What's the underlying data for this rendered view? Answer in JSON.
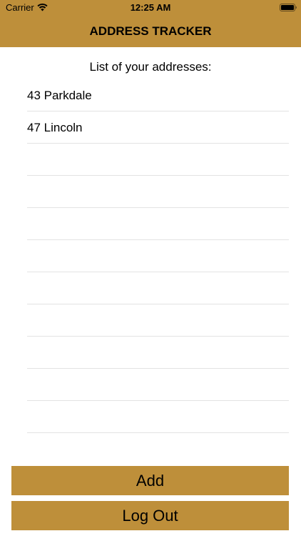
{
  "status_bar": {
    "carrier": "Carrier",
    "time": "12:25 AM",
    "wifi_icon": "wifi-icon",
    "battery_icon": "battery-full-icon"
  },
  "nav": {
    "title": "ADDRESS TRACKER",
    "background_color": "#BE8F3A"
  },
  "list": {
    "heading": "List of your addresses:",
    "items": [
      "43 Parkdale",
      "47 Lincoln",
      "",
      "",
      "",
      "",
      "",
      "",
      "",
      "",
      "",
      ""
    ]
  },
  "buttons": {
    "add_label": "Add",
    "logout_label": "Log Out",
    "color": "#BE8F3A"
  }
}
